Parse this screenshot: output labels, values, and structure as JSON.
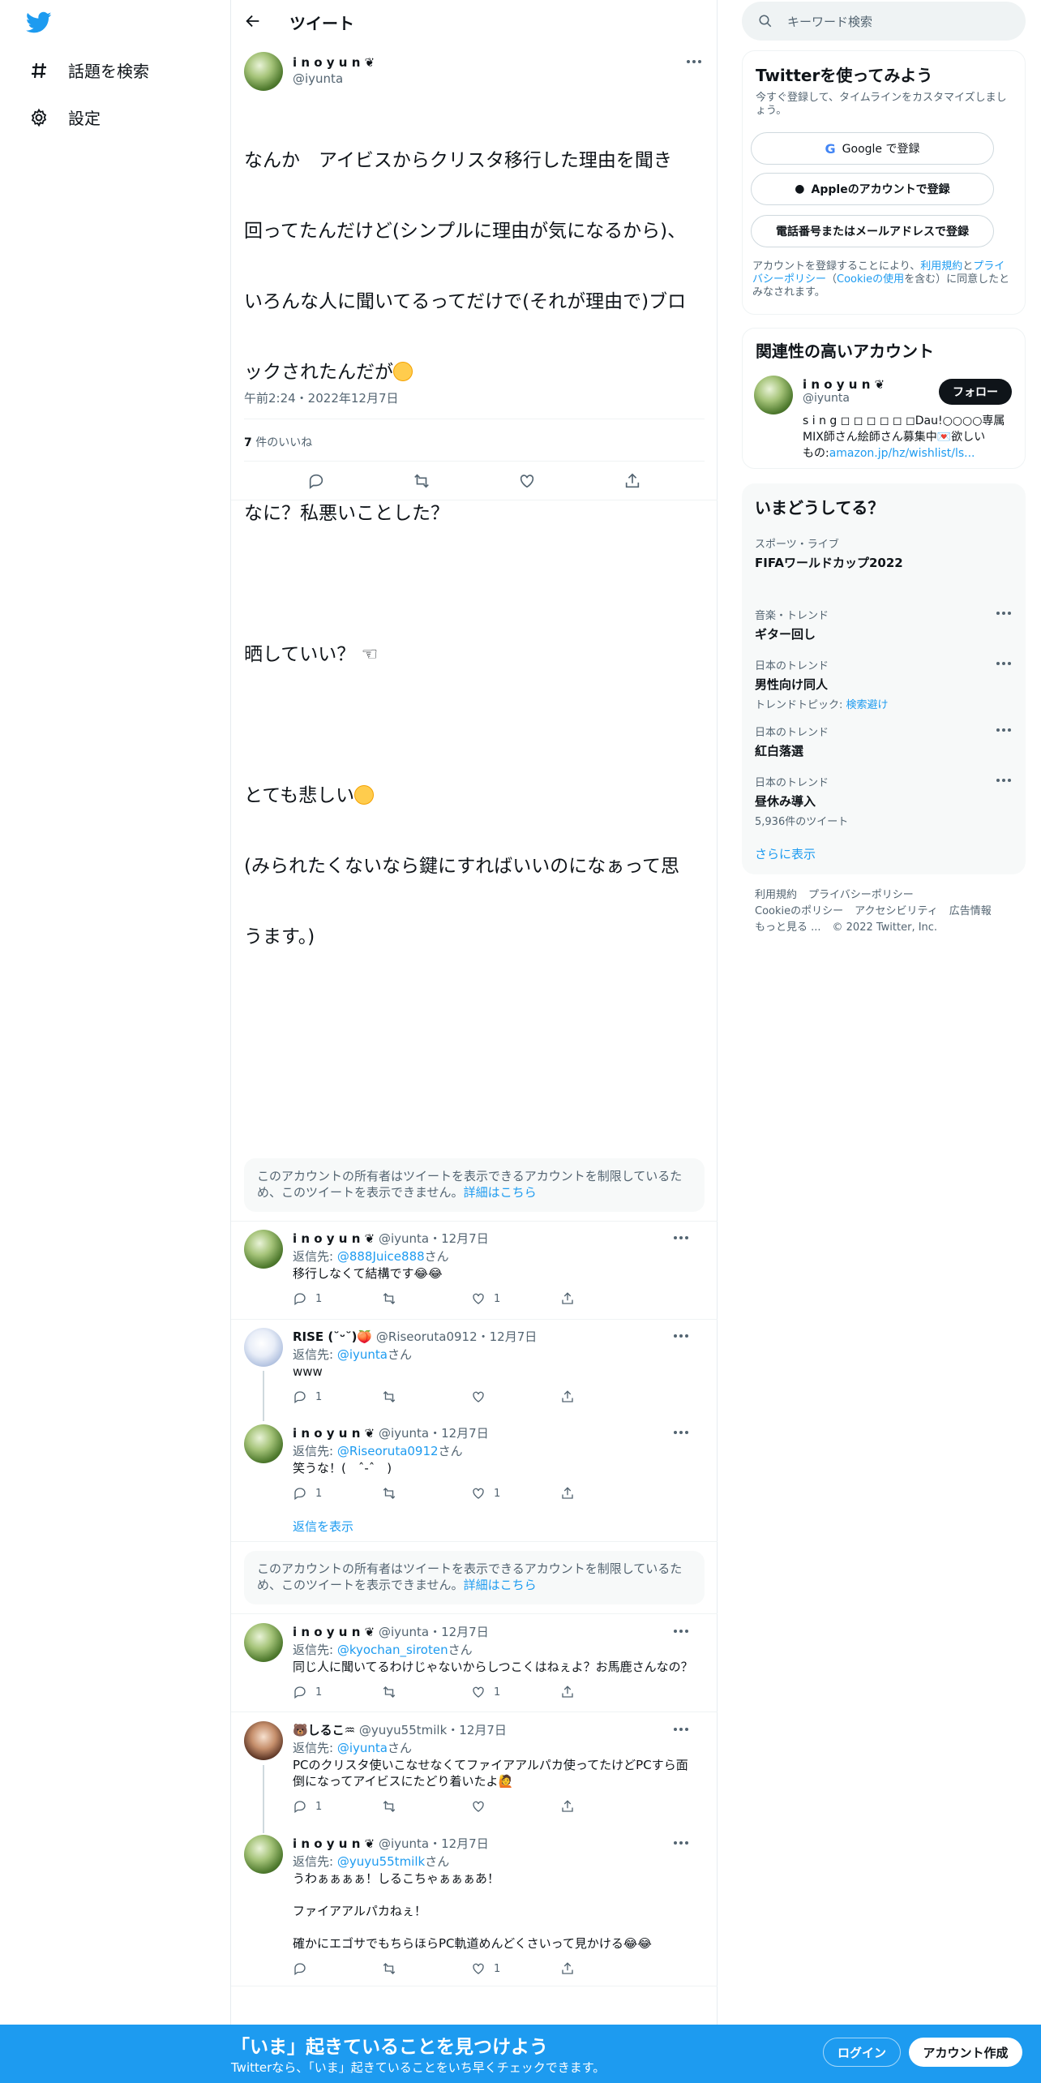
{
  "nav": {
    "explore": "話題を検索",
    "settings": "設定"
  },
  "header": {
    "title": "ツイート"
  },
  "tweet": {
    "name": "i n o y u n ❦",
    "handle": "@iyunta",
    "text_lines": [
      "なんか　アイビスからクリスタ移行した理由を聞き",
      "回ってたんだけど(シンプルに理由が気になるから)、",
      "いろんな人に聞いてるってだけで(それが理由で)ブロ",
      "ックされたんだが",
      "",
      "なに？私悪いことした？",
      "",
      "晒していい？ ☜",
      "",
      "とても悲しい",
      "(みられたくないなら鍵にすればいいのになぁって思",
      "うます。)"
    ],
    "meta": "午前2:24・2022年12月7日",
    "likes_count": "7",
    "likes_label": " 件のいいね"
  },
  "notice": {
    "text": "このアカウントの所有者はツイートを表示できるアカウントを制限しているため、このツイートを表示できません。",
    "link": "詳細はこちら"
  },
  "replies": [
    {
      "name": "i n o y u n ❦",
      "meta": "@iyunta・12月7日",
      "to_label": "返信先: ",
      "to": "@888Juice888",
      "to_suffix": "さん",
      "body": "移行しなくて結構です😂😂",
      "reply": "1",
      "rt": "",
      "like": "1"
    },
    {
      "name": "RISE (˘ᵕ˘)🍑",
      "meta": "@Riseoruta0912・12月7日",
      "to_label": "返信先: ",
      "to": "@iyunta",
      "to_suffix": "さん",
      "body": "www",
      "reply": "1",
      "rt": "",
      "like": ""
    },
    {
      "name": "i n o y u n ❦",
      "meta": "@iyunta・12月7日",
      "to_label": "返信先: ",
      "to": "@Riseoruta0912",
      "to_suffix": "さん",
      "body": "笑うな！(　ˆ-ˆ　)",
      "reply": "1",
      "rt": "",
      "like": "1"
    },
    {
      "name": "i n o y u n ❦",
      "meta": "@iyunta・12月7日",
      "to_label": "返信先: ",
      "to": "@kyochan_siroten",
      "to_suffix": "さん",
      "body": "同じ人に聞いてるわけじゃないからしつこくはねぇよ？お馬鹿さんなの？",
      "reply": "1",
      "rt": "",
      "like": "1"
    },
    {
      "name": "🐻しるこ♒",
      "meta": "@yuyu55tmilk・12月7日",
      "to_label": "返信先: ",
      "to": "@iyunta",
      "to_suffix": "さん",
      "body": "PCのクリスタ使いこなせなくてファイアアルパカ使ってたけどPCすら面\n倒になってアイビスにたどり着いたよ🙋",
      "reply": "1",
      "rt": "",
      "like": ""
    },
    {
      "name": "i n o y u n ❦",
      "meta": "@iyunta・12月7日",
      "to_label": "返信先: ",
      "to": "@yuyu55tmilk",
      "to_suffix": "さん",
      "body": "うわぁぁぁぁ！しるこちゃぁぁぁあ！\n\nファイアアルパカねぇ！\n\n確かにエゴサでもちらほらPC軌道めんどくさいって見かける😂😂",
      "reply": "",
      "rt": "",
      "like": "1"
    }
  ],
  "show_replies": "返信を表示",
  "right": {
    "search_placeholder": "キーワード検索",
    "signup_card": {
      "title": "Twitterを使ってみよう",
      "desc": "今すぐ登録して、タイムラインをカスタマイズしましょう。",
      "google": "Google で登録",
      "apple": "Appleのアカウントで登録",
      "phone": "電話番号またはメールアドレスで登録",
      "terms_pre": "アカウントを登録することにより、",
      "terms_link": "利用規約",
      "terms_and": "と",
      "privacy_link": "プライバシーポリシー",
      "cookie_open": "（",
      "cookie_link": "Cookieの使用",
      "terms_post": "を含む）に同意したとみなされます。"
    },
    "related": {
      "title": "関連性の高いアカウント",
      "name": "i n o y u n ❦",
      "handle": "@iyunta",
      "follow": "フォロー",
      "bio_1": "s i n g ◻ ◻ ◻ ◻ ◻ ◻Dau!○○○○専属",
      "bio_2": "MIX師さん絵師さん募集中💌欲しい",
      "bio_3": "もの:",
      "bio_link": "amazon.jp/hz/wishlist/ls..."
    },
    "trends": {
      "title": "いまどうしてる？",
      "items": [
        {
          "cat": "スポーツ・ライブ",
          "title": "FIFAワールドカップ2022",
          "sub": ""
        },
        {
          "cat": "音楽・トレンド",
          "title": "ギター回し",
          "sub": ""
        },
        {
          "cat": "日本のトレンド",
          "title": "男性向け同人",
          "sub_pre": "トレンドトピック: ",
          "sub_link": "検索避け"
        },
        {
          "cat": "日本のトレンド",
          "title": "紅白落選",
          "sub": ""
        },
        {
          "cat": "日本のトレンド",
          "title": "昼休み導入",
          "sub": "5,936件のツイート"
        }
      ],
      "more": "さらに表示"
    },
    "footer": [
      "利用規約",
      "プライバシーポリシー",
      "Cookieのポリシー",
      "アクセシビリティ",
      "広告情報",
      "もっと見る ...",
      "© 2022 Twitter, Inc."
    ]
  },
  "bottom": {
    "title": "「いま」起きていることを見つけよう",
    "subtitle": "Twitterなら、「いま」起きていることをいち早くチェックできます。",
    "login": "ログイン",
    "signup": "アカウント作成"
  },
  "colors": {
    "accent": "#1d9bf0",
    "text": "#0f1419",
    "muted": "#536471"
  }
}
